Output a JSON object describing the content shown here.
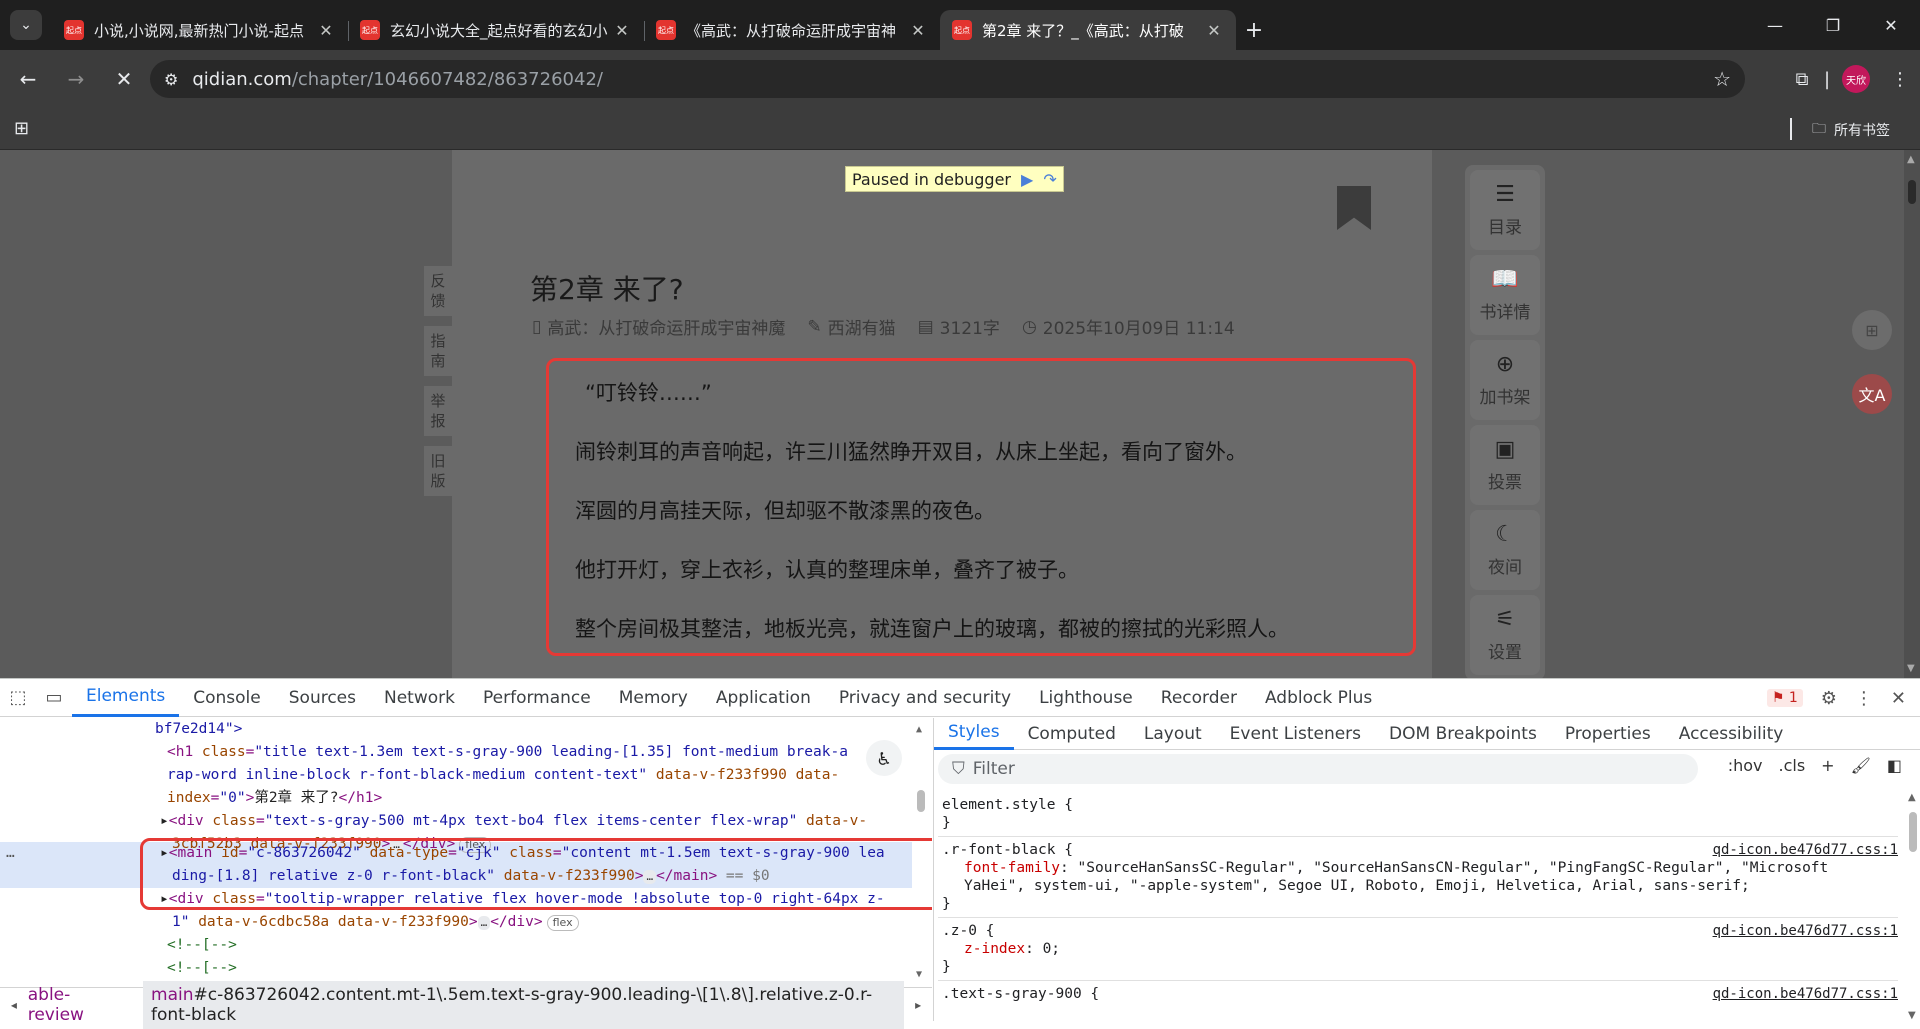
{
  "browser": {
    "tabs": [
      {
        "favicon": "起点",
        "title": "小说,小说网,最新热门小说-起点",
        "active": false
      },
      {
        "favicon": "起点",
        "title": "玄幻小说大全_起点好看的玄幻小",
        "active": false
      },
      {
        "favicon": "起点",
        "title": "《高武：从打破命运肝成宇宙神",
        "active": false
      },
      {
        "favicon": "起点",
        "title": "第2章 来了？_《高武：从打破",
        "active": true
      }
    ],
    "new_tab": "+",
    "url_host": "qidian.com",
    "url_path": "/chapter/1046607482/863726042/",
    "profile_label": "天欣",
    "all_bookmarks": "所有书签"
  },
  "page": {
    "debugger_banner": "Paused in debugger",
    "feedback": [
      {
        "label": "反\n馈"
      },
      {
        "label": "指\n南"
      },
      {
        "label": "举\n报"
      },
      {
        "label": "旧\n版"
      }
    ],
    "chapter_title": "第2章 来了?",
    "meta": {
      "book": "高武：从打破命运肝成宇宙神魔",
      "author": "西湖有猫",
      "words": "3121字",
      "date": "2025年10月09日 11:14"
    },
    "paragraphs": [
      "“叮铃铃……”",
      "闹铃刺耳的声音响起，许三川猛然睁开双目，从床上坐起，看向了窗外。",
      "浑圆的月高挂天际，但却驱不散漆黑的夜色。",
      "他打开灯，穿上衣衫，认真的整理床单，叠齐了被子。",
      "整个房间极其整洁，地板光亮，就连窗户上的玻璃，都被的擦拭的光彩照人。"
    ],
    "sidebar": [
      {
        "icon": "list-icon",
        "label": "目录"
      },
      {
        "icon": "book-open-icon",
        "label": "书详情"
      },
      {
        "icon": "shelf-add-icon",
        "label": "加书架"
      },
      {
        "icon": "ticket-icon",
        "label": "投票"
      },
      {
        "icon": "moon-icon",
        "label": "夜间"
      },
      {
        "icon": "sliders-icon",
        "label": "设置"
      }
    ]
  },
  "devtools": {
    "tabs": [
      "Elements",
      "Console",
      "Sources",
      "Network",
      "Performance",
      "Memory",
      "Application",
      "Privacy and security",
      "Lighthouse",
      "Recorder",
      "Adblock Plus"
    ],
    "active_tab": "Elements",
    "issues_count": "1",
    "elements": {
      "line0": "bf7e2d14\">",
      "h1_class": "title text-1.3em text-s-gray-900 leading-[1.35] font-medium break-a",
      "h1_class2": "rap-word inline-block r-font-black-medium content-text",
      "h1_dv": "data-v-f233f990",
      "h1_idx_attr": "data-",
      "h1_idx_attr2": "index",
      "h1_idx_val": "\"0\"",
      "h1_text": "第2章 来了?",
      "div1_class": "\"text-s-gray-500 mt-4px text-bo4 flex items-center flex-wrap\"",
      "div1_dv": "data-v-",
      "div1_dv2": "3cbf52b3 data-v-f233f990",
      "main_id": "\"c-863726042\"",
      "main_type": "\"cjk\"",
      "main_class": "\"content mt-1.5em text-s-gray-900 lea",
      "main_class2": "ding-[1.8] relative z-0 r-font-black\"",
      "main_dv": "data-v-f233f990",
      "main_eq": "== $0",
      "div2_class": "\"tooltip-wrapper relative flex hover-mode !absolute top-0 right-64px z-",
      "div2_class2": "1\"",
      "div2_dv": "data-v-6cdbc58a data-v-f233f990",
      "comment": "<!--[-->",
      "flex_badge": "flex",
      "dots": "…"
    },
    "breadcrumb": {
      "first": "able-review",
      "second_tag": "main",
      "second_rest": "#c-863726042.content.mt-1\\.5em.text-s-gray-900.leading-\\[1\\.8\\].relative.z-0.r-font-black"
    },
    "styles_tabs": [
      "Styles",
      "Computed",
      "Layout",
      "Event Listeners",
      "DOM Breakpoints",
      "Properties",
      "Accessibility"
    ],
    "styles_active": "Styles",
    "filter_placeholder": "Filter",
    "hov": ":hov",
    "cls": ".cls",
    "rules": [
      {
        "selector": "element.style {",
        "props": [],
        "close": "}",
        "source": ""
      },
      {
        "selector": ".r-font-black {",
        "props": [
          {
            "name": "font-family",
            "value": "\"SourceHanSansSC-Regular\", \"SourceHanSansCN-Regular\", \"PingFangSC-Regular\", \"Microsoft YaHei\", system-ui, \"-apple-system\", Segoe UI, Roboto, Emoji, Helvetica, Arial, sans-serif;"
          }
        ],
        "close": "}",
        "source": "qd-icon.be476d77.css:1"
      },
      {
        "selector": ".z-0 {",
        "props": [
          {
            "name": "z-index",
            "value": "0;"
          }
        ],
        "close": "}",
        "source": "qd-icon.be476d77.css:1"
      },
      {
        "selector": ".text-s-gray-900 {",
        "props": [],
        "close": "",
        "source": "qd-icon.be476d77.css:1"
      }
    ]
  },
  "colors": {
    "accent": "#1a73e8",
    "highlight": "#e53935"
  }
}
